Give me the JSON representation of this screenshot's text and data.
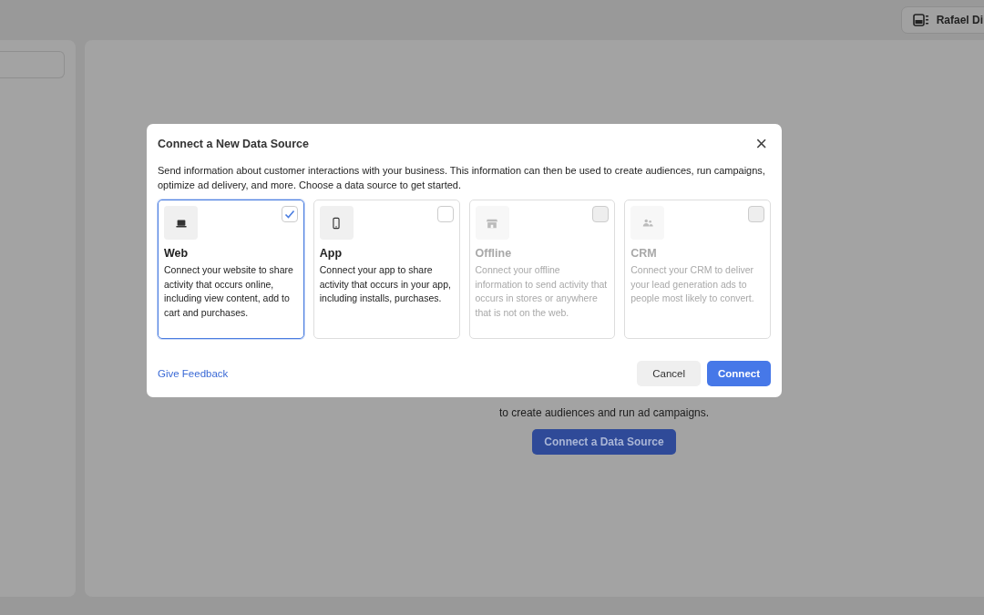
{
  "account": {
    "name": "Rafael Di"
  },
  "background": {
    "description": "to create audiences and run ad campaigns.",
    "button": "Connect a Data Source"
  },
  "dialog": {
    "title": "Connect a New Data Source",
    "close": "×",
    "intro": "Send information about customer interactions with your business. This information can then be used to create audiences, run campaigns, optimize ad delivery, and more. Choose a data source to get started.",
    "sources": [
      {
        "kind": "web",
        "title": "Web",
        "description": "Connect your website to share activity that occurs online, including view content, add to cart and purchases.",
        "selected": true,
        "disabled": false
      },
      {
        "kind": "app",
        "title": "App",
        "description": "Connect your app to share activity that occurs in your app, including installs, purchases.",
        "selected": false,
        "disabled": false
      },
      {
        "kind": "offline",
        "title": "Offline",
        "description": "Connect your offline information to send activity that occurs in stores or anywhere that is not on the web.",
        "selected": false,
        "disabled": true
      },
      {
        "kind": "crm",
        "title": "CRM",
        "description": "Connect your CRM to deliver your lead generation ads to people most likely to convert.",
        "selected": false,
        "disabled": true
      }
    ],
    "feedback_link": "Give Feedback",
    "cancel_button": "Cancel",
    "connect_button": "Connect"
  }
}
